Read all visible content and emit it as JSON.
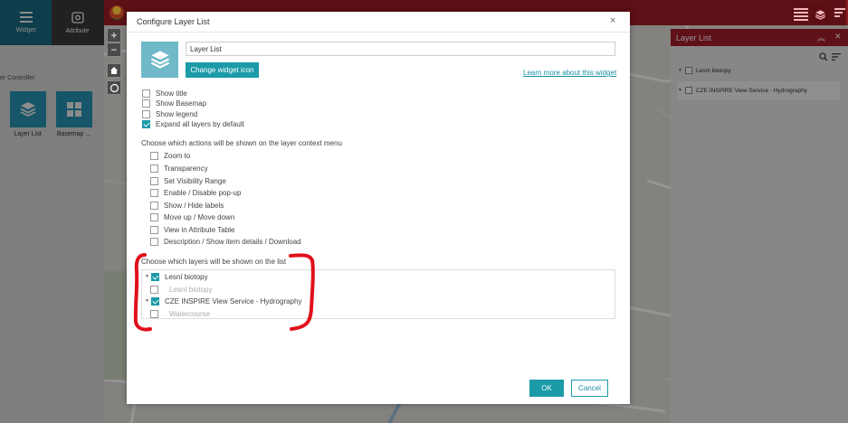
{
  "left_panel": {
    "tabs": [
      {
        "label": "Widget",
        "icon": "hamburger-icon"
      },
      {
        "label": "Attribute",
        "icon": "gear-icon"
      }
    ],
    "section_label": "er Controller",
    "widgets": [
      {
        "label": "Layer List",
        "icon": "layers-icon"
      },
      {
        "label": "Basemap ...",
        "icon": "grid-icon"
      }
    ]
  },
  "map": {
    "zoom_in": "+",
    "zoom_out": "−"
  },
  "layer_panel": {
    "title": "Layer List",
    "items": [
      {
        "label": "Lesní biotopy"
      },
      {
        "label": "CZE INSPIRE View Service - Hydrography"
      }
    ]
  },
  "dialog": {
    "title": "Configure Layer List",
    "close": "×",
    "widget_name": "Layer List",
    "change_icon_label": "Change widget icon",
    "learn_more": "Learn more about this widget",
    "display_options": [
      {
        "label": "Show title",
        "checked": false
      },
      {
        "label": "Show Basemap",
        "checked": false
      },
      {
        "label": "Show legend",
        "checked": false
      },
      {
        "label": "Expand all layers by default",
        "checked": true
      }
    ],
    "actions_label": "Choose which actions will be shown on the layer context menu",
    "actions": [
      {
        "label": "Zoom to",
        "checked": false
      },
      {
        "label": "Transparency",
        "checked": false
      },
      {
        "label": "Set Visibility Range",
        "checked": false
      },
      {
        "label": "Enable / Disable pop-up",
        "checked": false
      },
      {
        "label": "Show / Hide labels",
        "checked": false
      },
      {
        "label": "Move up / Move down",
        "checked": false
      },
      {
        "label": "View in Attribute Table",
        "checked": false
      },
      {
        "label": "Description / Show item details / Download",
        "checked": false
      }
    ],
    "layers_label": "Choose which layers will be shown on the list",
    "layers": [
      {
        "label": "Lesní biotopy",
        "checked": true,
        "level": 0
      },
      {
        "label": "Lesní biotopy",
        "checked": false,
        "level": 1
      },
      {
        "label": "CZE INSPIRE View Service - Hydrography",
        "checked": true,
        "level": 0
      },
      {
        "label": "Watercourse",
        "checked": false,
        "level": 1
      }
    ],
    "ok_label": "OK",
    "cancel_label": "Cancel"
  },
  "colors": {
    "accent": "#1b9aa8",
    "header_red": "#a51d2a",
    "annotation_red": "#e0101c"
  }
}
